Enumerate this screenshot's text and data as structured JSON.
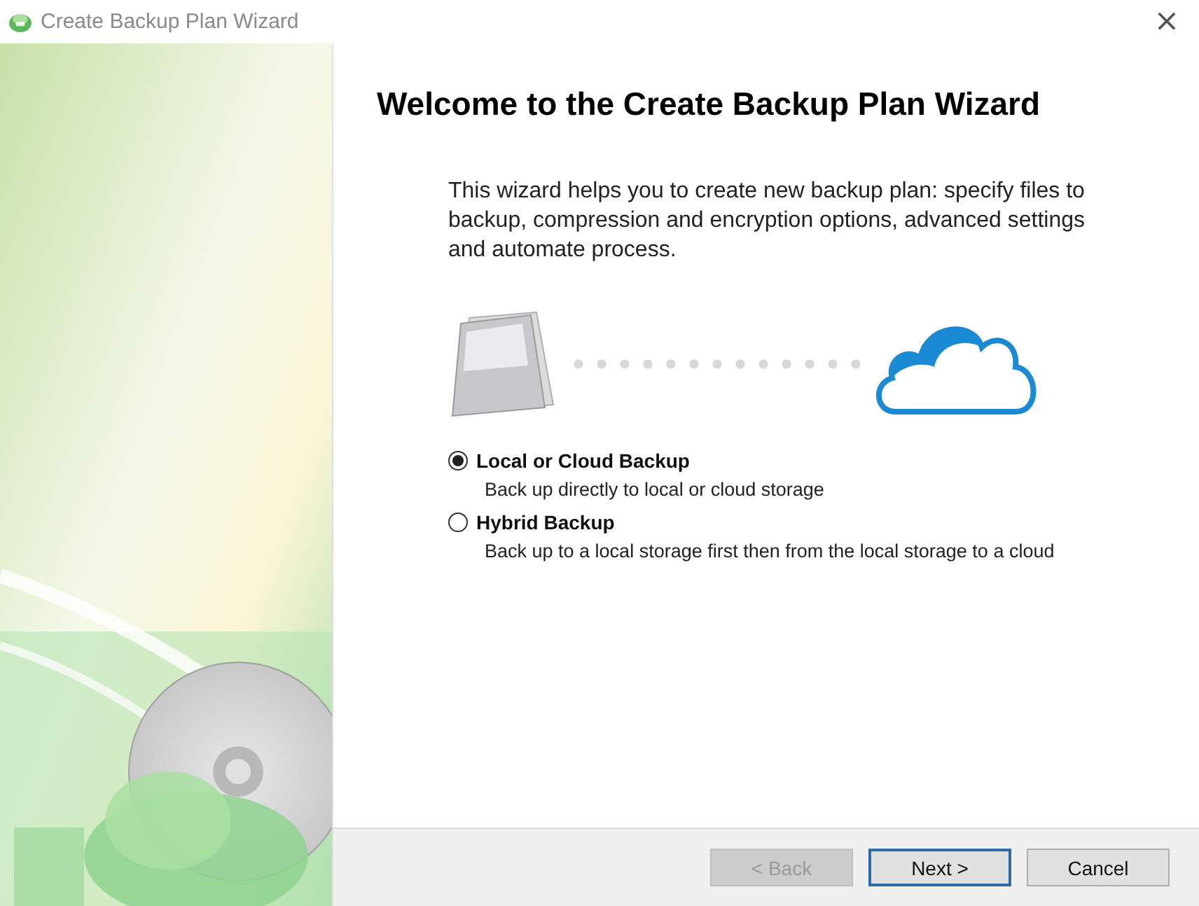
{
  "window": {
    "title": "Create Backup Plan Wizard",
    "close": "×"
  },
  "heading": "Welcome to the Create Backup Plan Wizard",
  "intro": "This wizard helps you to create new backup plan: specify files to backup, compression and encryption options, advanced settings and automate process.",
  "options": [
    {
      "label": "Local or Cloud Backup",
      "description": "Back up directly to local or cloud storage",
      "selected": true
    },
    {
      "label": "Hybrid Backup",
      "description": "Back up to a local storage first then from the local storage to a cloud",
      "selected": false
    }
  ],
  "buttons": [
    {
      "label": "< Back",
      "disabled": true,
      "default": false
    },
    {
      "label": "Next >",
      "disabled": false,
      "default": true
    },
    {
      "label": "Cancel",
      "disabled": false,
      "default": false
    }
  ]
}
